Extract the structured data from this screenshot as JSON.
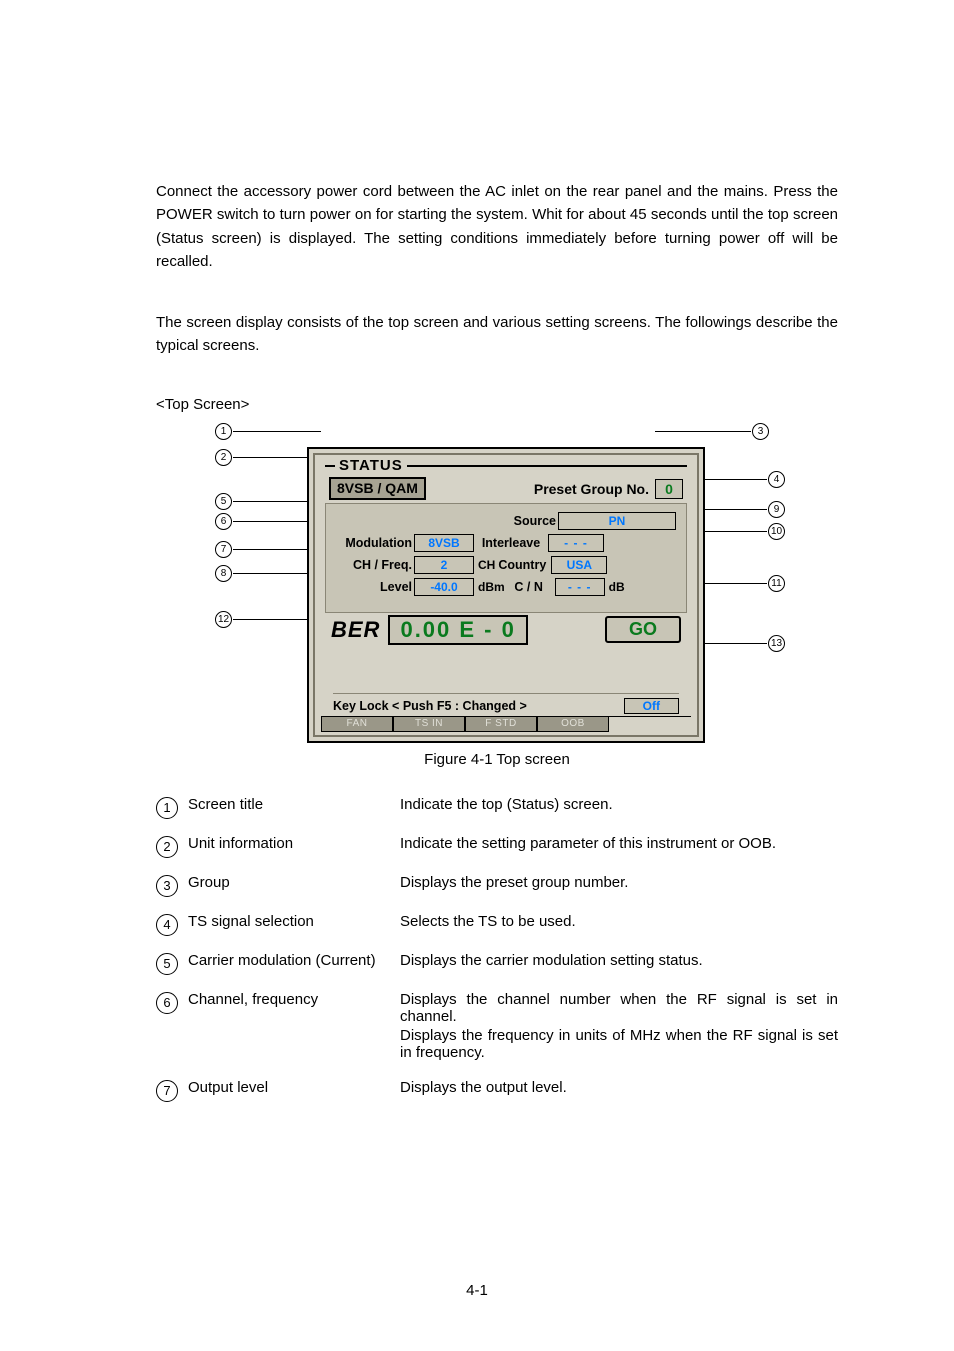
{
  "paragraph1": "Connect the accessory power cord between the AC inlet on the rear panel and the mains. Press the POWER switch to turn power on for starting the system.  Whit for about 45 seconds until the top screen (Status screen) is displayed.  The setting conditions immediately before turning power off will be recalled.",
  "paragraph2": "The screen display consists of the top screen and various setting screens.  The followings describe the typical screens.",
  "subhead": "<Top Screen>",
  "screenshot": {
    "status_title": "STATUS",
    "tab": "8VSB / QAM",
    "preset_label": "Preset Group No.",
    "preset_value": "0",
    "source_label": "Source",
    "source_value": "PN",
    "modulation_label": "Modulation",
    "modulation_value": "8VSB",
    "interleave_label": "Interleave",
    "interleave_value": "- - -",
    "chfreq_label": "CH / Freq.",
    "chfreq_value": "2",
    "chfreq_unit": "CH",
    "country_label": "Country",
    "country_value": "USA",
    "level_label": "Level",
    "level_value": "-40.0",
    "level_unit": "dBm",
    "cn_label": "C / N",
    "cn_value": "- - -",
    "cn_unit": "dB",
    "ber_label": "BER",
    "ber_value": "0.00 E - 0",
    "go": "GO",
    "keylock_label": "Key Lock < Push F5 : Changed >",
    "keylock_value": "Off",
    "tabs": [
      "FAN",
      "TS IN",
      "F STD",
      "OOB"
    ],
    "callouts": {
      "c1": "1",
      "c2": "2",
      "c3": "3",
      "c4": "4",
      "c5": "5",
      "c6": "6",
      "c7": "7",
      "c8": "8",
      "c9": "9",
      "c10": "10",
      "c11": "11",
      "c12": "12",
      "c13": "13"
    }
  },
  "caption": "Figure 4-1    Top screen",
  "legend": [
    {
      "n": "1",
      "term": "Screen title",
      "desc": [
        "Indicate the top (Status) screen."
      ]
    },
    {
      "n": "2",
      "term": "Unit information",
      "desc": [
        "Indicate the setting parameter of this instrument or OOB."
      ]
    },
    {
      "n": "3",
      "term": "Group",
      "desc": [
        "Displays the preset group number."
      ]
    },
    {
      "n": "4",
      "term": "TS signal selection",
      "desc": [
        "Selects the TS to be used."
      ]
    },
    {
      "n": "5",
      "term": "Carrier modulation (Current)",
      "desc": [
        "Displays the carrier modulation setting status."
      ]
    },
    {
      "n": "6",
      "term": "Channel, frequency",
      "desc": [
        "Displays the channel number when the RF signal is set in  channel.",
        "Displays the frequency in units of MHz when the RF signal is set in frequency."
      ]
    },
    {
      "n": "7",
      "term": "Output level",
      "desc": [
        "Displays the output level."
      ]
    }
  ],
  "pagenum": "4-1"
}
